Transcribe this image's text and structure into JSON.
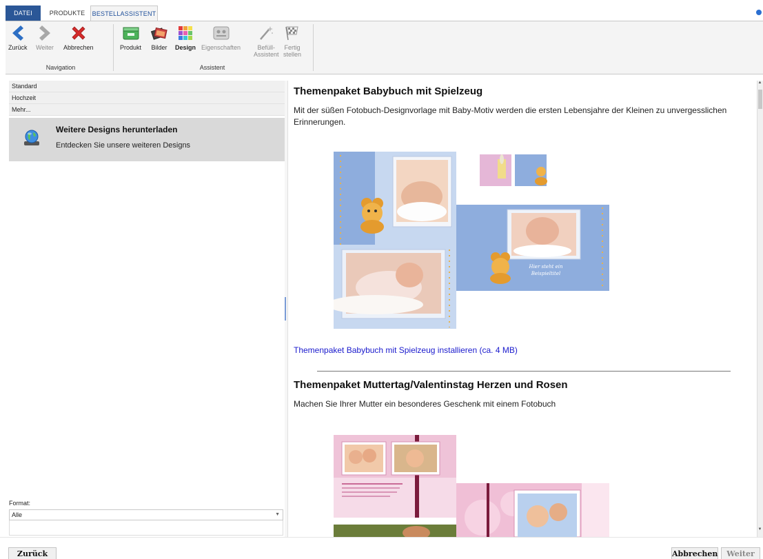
{
  "tabs": {
    "datei": "DATEI",
    "produkte": "PRODUKTE",
    "bestellassistent": "BESTELLASSISTENT"
  },
  "ribbon": {
    "navigation": {
      "label": "Navigation",
      "back": "Zurück",
      "next": "Weiter",
      "cancel": "Abbrechen"
    },
    "assistent": {
      "label": "Assistent",
      "produkt": "Produkt",
      "bilder": "Bilder",
      "design": "Design",
      "eigenschaften": "Eigenschaften",
      "befuell_line1": "Befüll-",
      "befuell_line2": "Assistent",
      "fertig_line1": "Fertig",
      "fertig_line2": "stellen"
    }
  },
  "sidebar": {
    "categories": [
      "Standard",
      "Hochzeit",
      "Mehr..."
    ],
    "download": {
      "title": "Weitere Designs herunterladen",
      "subtitle": "Entdecken Sie unsere weiteren Designs"
    },
    "format_label": "Format:",
    "format_value": "Alle"
  },
  "content": {
    "item1": {
      "title": "Themenpaket Babybuch mit Spielzeug",
      "description": "Mit der süßen Fotobuch-Designvorlage mit Baby-Motiv werden die ersten Lebensjahre der Kleinen zu unvergesslichen Erinnerungen.",
      "install_link": "Themenpaket Babybuch mit Spielzeug installieren (ca. 4 MB)",
      "preview_caption_line1": "Hier steht ein",
      "preview_caption_line2": "Beispieltitel"
    },
    "item2": {
      "title": "Themenpaket Muttertag/Valentinstag Herzen und Rosen",
      "description": "Machen Sie Ihrer Mutter ein besonderes Geschenk mit einem Fotobuch"
    }
  },
  "footer": {
    "back": "Zurück",
    "cancel": "Abbrechen",
    "next": "Weiter"
  },
  "colors": {
    "accent": "#2b5797",
    "link": "#1a1acd",
    "baby_blue": "#8fb0df",
    "pink": "#e8a6c6"
  }
}
